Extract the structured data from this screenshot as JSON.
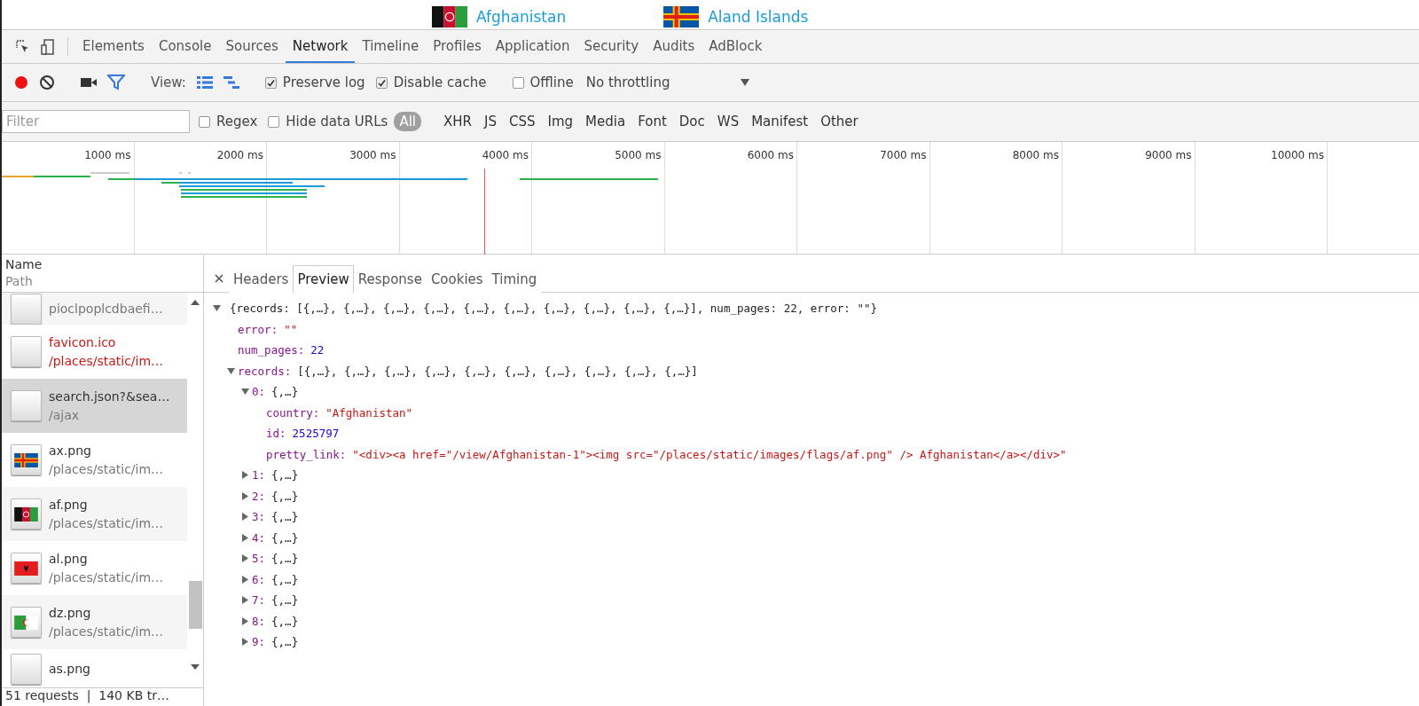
{
  "page_links": [
    {
      "label": "Afghanistan",
      "kind": "afghanistan"
    },
    {
      "label": "Aland Islands",
      "kind": "aland"
    }
  ],
  "panel_tabs": [
    {
      "label": "Elements",
      "selected": false
    },
    {
      "label": "Console",
      "selected": false
    },
    {
      "label": "Sources",
      "selected": false
    },
    {
      "label": "Network",
      "selected": true
    },
    {
      "label": "Timeline",
      "selected": false
    },
    {
      "label": "Profiles",
      "selected": false
    },
    {
      "label": "Application",
      "selected": false
    },
    {
      "label": "Security",
      "selected": false
    },
    {
      "label": "Audits",
      "selected": false
    },
    {
      "label": "AdBlock",
      "selected": false
    }
  ],
  "toolbar": {
    "recording": true,
    "filter_active": true,
    "view_label": "View:",
    "checkboxes": [
      {
        "label": "Preserve log",
        "checked": true
      },
      {
        "label": "Disable cache",
        "checked": true
      },
      {
        "label": "Offline",
        "checked": false
      }
    ],
    "throttling": "No throttling"
  },
  "filter": {
    "placeholder": "Filter",
    "options": [
      {
        "label": "Regex",
        "checked": false
      },
      {
        "label": "Hide data URLs",
        "checked": false
      }
    ],
    "types": [
      {
        "label": "All",
        "selected": true
      },
      {
        "label": "XHR",
        "selected": false
      },
      {
        "label": "JS",
        "selected": false
      },
      {
        "label": "CSS",
        "selected": false
      },
      {
        "label": "Img",
        "selected": false
      },
      {
        "label": "Media",
        "selected": false
      },
      {
        "label": "Font",
        "selected": false
      },
      {
        "label": "Doc",
        "selected": false
      },
      {
        "label": "WS",
        "selected": false
      },
      {
        "label": "Manifest",
        "selected": false
      },
      {
        "label": "Other",
        "selected": false
      }
    ]
  },
  "overview": {
    "ticks": [
      "1000 ms",
      "2000 ms",
      "3000 ms",
      "4000 ms",
      "5000 ms",
      "6000 ms",
      "7000 ms",
      "8000 ms",
      "9000 ms",
      "10000 ms"
    ]
  },
  "list_header": {
    "name": "Name",
    "path": "Path"
  },
  "requests": [
    {
      "path": "pioclpoplcdbaefi…",
      "kind": "blank",
      "failed": false,
      "selected": false
    },
    {
      "name": "favicon.ico",
      "path": "/places/static/im…",
      "kind": "blank",
      "failed": true,
      "selected": false
    },
    {
      "name": "search.json?&sea…",
      "path": "/ajax",
      "kind": "blank",
      "failed": false,
      "selected": true
    },
    {
      "name": "ax.png",
      "path": "/places/static/im…",
      "kind": "aland",
      "failed": false,
      "selected": false
    },
    {
      "name": "af.png",
      "path": "/places/static/im…",
      "kind": "afghanistan",
      "failed": false,
      "selected": false
    },
    {
      "name": "al.png",
      "path": "/places/static/im…",
      "kind": "albania",
      "failed": false,
      "selected": false
    },
    {
      "name": "dz.png",
      "path": "/places/static/im…",
      "kind": "algeria",
      "failed": false,
      "selected": false
    },
    {
      "name": "as.png",
      "kind": "blank",
      "failed": false,
      "selected": false
    }
  ],
  "summary": "51 requests  |  140 KB tr…",
  "detail_tabs": [
    {
      "label": "Headers",
      "selected": false
    },
    {
      "label": "Preview",
      "selected": true
    },
    {
      "label": "Response",
      "selected": false
    },
    {
      "label": "Cookies",
      "selected": false
    },
    {
      "label": "Timing",
      "selected": false
    }
  ],
  "preview": {
    "kind": "object",
    "value": "{records: [{,…}, {,…}, {,…}, {,…}, {,…}, {,…}, {,…}, {,…}, {,…}, {,…}], num_pages: 22, error: \"\"}",
    "expanded": true,
    "children": [
      {
        "key": "error:",
        "kind": "string",
        "value": "\"\""
      },
      {
        "key": "num_pages:",
        "kind": "number",
        "value": "22"
      },
      {
        "key": "records:",
        "kind": "object",
        "value": "[{,…}, {,…}, {,…}, {,…}, {,…}, {,…}, {,…}, {,…}, {,…}, {,…}]",
        "expanded": true,
        "children": [
          {
            "key": "0:",
            "kind": "object",
            "value": "{,…}",
            "expanded": true,
            "children": [
              {
                "key": "country:",
                "kind": "string",
                "value": "\"Afghanistan\""
              },
              {
                "key": "id:",
                "kind": "number",
                "value": "2525797"
              },
              {
                "key": "pretty_link:",
                "kind": "string",
                "value": "\"<div><a href=\"/view/Afghanistan-1\"><img src=\"/places/static/images/flags/af.png\" /> Afghanistan</a></div>\""
              }
            ]
          },
          {
            "key": "1:",
            "kind": "object",
            "value": "{,…}",
            "expanded": false
          },
          {
            "key": "2:",
            "kind": "object",
            "value": "{,…}",
            "expanded": false
          },
          {
            "key": "3:",
            "kind": "object",
            "value": "{,…}",
            "expanded": false
          },
          {
            "key": "4:",
            "kind": "object",
            "value": "{,…}",
            "expanded": false
          },
          {
            "key": "5:",
            "kind": "object",
            "value": "{,…}",
            "expanded": false
          },
          {
            "key": "6:",
            "kind": "object",
            "value": "{,…}",
            "expanded": false
          },
          {
            "key": "7:",
            "kind": "object",
            "value": "{,…}",
            "expanded": false
          },
          {
            "key": "8:",
            "kind": "object",
            "value": "{,…}",
            "expanded": false
          },
          {
            "key": "9:",
            "kind": "object",
            "value": "{,…}",
            "expanded": false
          }
        ]
      }
    ]
  }
}
